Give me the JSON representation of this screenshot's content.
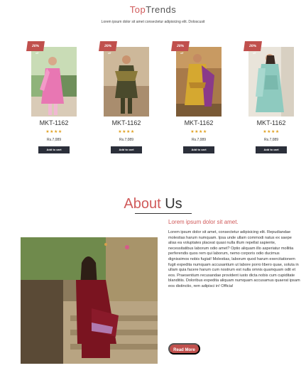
{
  "header": {
    "title_accent": "Top",
    "title_rest": "Trends",
    "subtitle": "Lorem ipsum dolor sit amet consectetur adipisicing elit. Doloscusit"
  },
  "products": [
    {
      "badge": "20%",
      "off": "off",
      "code": "MKT-1162",
      "stars": "★★★★",
      "price": "Rs.7,089",
      "cart_label": "Add to cart"
    },
    {
      "badge": "20%",
      "off": "off",
      "code": "MKT-1162",
      "stars": "★★★★",
      "price": "Rs.7,089",
      "cart_label": "Add to cart"
    },
    {
      "badge": "20%",
      "off": "off",
      "code": "MKT-1162",
      "stars": "★★★★",
      "price": "Rs.7,089",
      "cart_label": "Add to cart"
    },
    {
      "badge": "20%",
      "off": "off",
      "code": "MKT-1162",
      "stars": "★★★★",
      "price": "Rs.7,089",
      "cart_label": "Add to cart"
    }
  ],
  "about": {
    "title_accent": "About",
    "title_rest": "Us",
    "subtitle": "Lorem ipsum dolor sit amet.",
    "body": "Lorem ipsum dolor sit amet, consectetur adipisicing elit. Repudiandae molestias harum numquam. Ipsa unde ullam commodi natus ex saepe alias ea voluptates placeat quasi nulla illum repellat sapiente, necessitatibus laborum odio amet? Optio aliquam illo asperiatur mollitia perferendis quos rem qui laborum, nemo corporis odio ducimus dignissimos nobis fugiat! Molestias, laborum quod harum exercitationem fugit expedita numquam accusantium ut labore porro libero quae, soluta in ullam quia facere harum cum nostrum est nulla omnis quamquam odit et eos. Praesentium recusandae provident iusto dicta nobis cum cupiditate blanditiis. Doloribus expedita aliquam numquam accusamus quaerat ipsam eos distinctio, rem adipisci in! Officia!",
    "read_more_label": "Read More"
  },
  "colors": {
    "accent": "#d05a5a",
    "badge": "#c0504d",
    "cart_button": "#2b2f3a",
    "stars": "#e0a020"
  }
}
